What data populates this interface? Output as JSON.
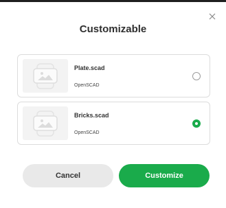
{
  "dialog": {
    "title": "Customizable",
    "options": [
      {
        "name": "Plate.scad",
        "type": "OpenSCAD",
        "selected": false
      },
      {
        "name": "Bricks.scad",
        "type": "OpenSCAD",
        "selected": true
      }
    ],
    "cancel_label": "Cancel",
    "confirm_label": "Customize"
  },
  "icons": {
    "close": "close-icon",
    "thumbnail": "image-placeholder-icon"
  },
  "colors": {
    "accent": "#1aab4b",
    "cancel_bg": "#e9e9e9"
  }
}
